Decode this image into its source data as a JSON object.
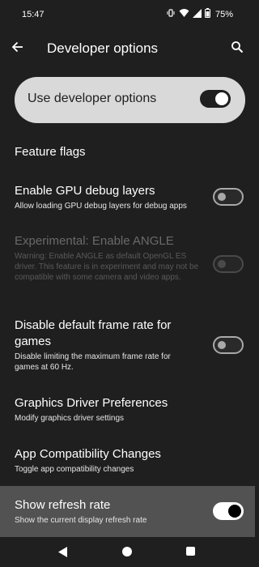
{
  "status_bar": {
    "time": "15:47",
    "battery_percent": "75%",
    "icons": [
      "vibrate-icon",
      "wifi-icon",
      "signal-icon",
      "battery-icon"
    ]
  },
  "app_bar": {
    "title": "Developer options",
    "back_icon": "arrow-left-icon",
    "search_icon": "search-icon"
  },
  "main_toggle": {
    "label": "Use developer options",
    "on": true
  },
  "section": {
    "title": "Feature flags"
  },
  "settings": [
    {
      "title": "Enable GPU debug layers",
      "summary": "Allow loading GPU debug layers for debug apps",
      "switch": "off",
      "enabled": true
    },
    {
      "title": "Experimental: Enable ANGLE",
      "summary": "Warning: Enable ANGLE as default OpenGL ES driver. This feature is in experiment and may not be compatible with some camera and video apps.",
      "switch": "off",
      "enabled": false
    },
    {
      "title": "Disable default frame rate for games",
      "summary": "Disable limiting the maximum frame rate for games at 60 Hz.",
      "switch": "off",
      "enabled": true
    },
    {
      "title": "Graphics Driver Preferences",
      "summary": "Modify graphics driver settings",
      "enabled": true
    },
    {
      "title": "App Compatibility Changes",
      "summary": "Toggle app compatibility changes",
      "enabled": true
    },
    {
      "title": "Show refresh rate",
      "summary": "Show the current display refresh rate",
      "switch": "on",
      "enabled": true,
      "highlighted": true
    }
  ],
  "nav_bar": {
    "icons": [
      "nav-back-icon",
      "nav-home-icon",
      "nav-recents-icon"
    ]
  },
  "colors": {
    "background": "#1f1f1f",
    "card": "#d9d9d9",
    "highlight": "#525252"
  }
}
